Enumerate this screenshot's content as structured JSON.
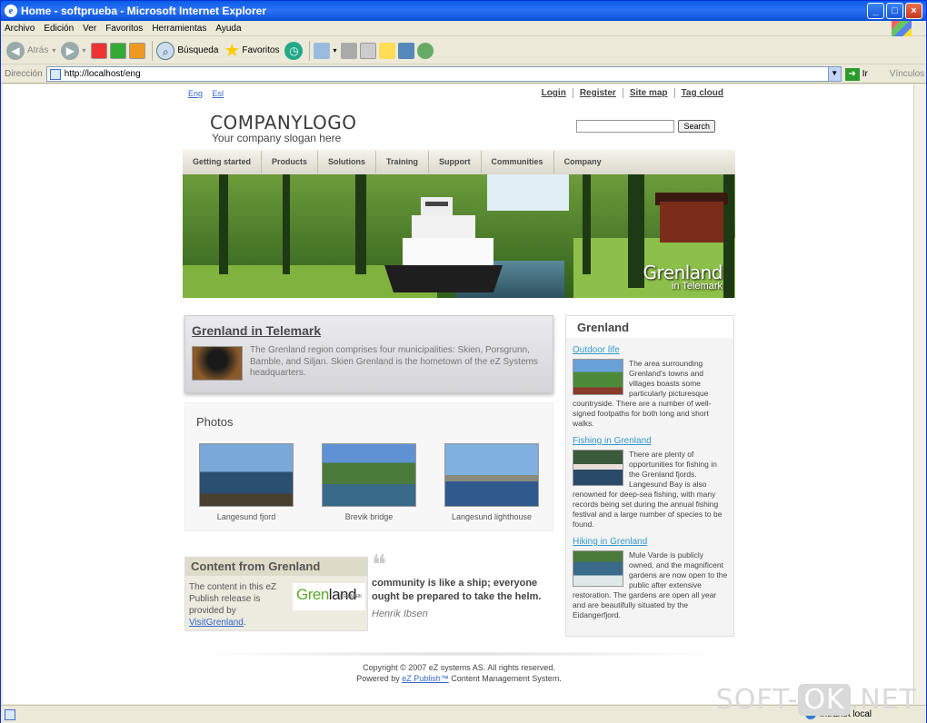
{
  "window": {
    "title": "Home - softprueba - Microsoft Internet Explorer",
    "min_label": "_",
    "max_label": "□",
    "close_label": "×"
  },
  "menu": [
    "Archivo",
    "Edición",
    "Ver",
    "Favoritos",
    "Herramientas",
    "Ayuda"
  ],
  "toolbar": {
    "back_label": "Atrás",
    "search_label": "Búsqueda",
    "favorites_label": "Favoritos"
  },
  "address": {
    "label": "Dirección",
    "url": "http://localhost/eng",
    "go_label": "Ir",
    "links_label": "Vínculos"
  },
  "status": {
    "zone": "Intranet local"
  },
  "watermark": {
    "pre": "SOFT-",
    "ok": "OK",
    "post": ".NET"
  },
  "site": {
    "lang": [
      "Eng",
      "Esl"
    ],
    "top_links": [
      "Login",
      "Register",
      "Site map",
      "Tag cloud"
    ],
    "logo": "COMPANYLOGO",
    "slogan": "Your company slogan here",
    "search_button": "Search",
    "nav": [
      "Getting started",
      "Products",
      "Solutions",
      "Training",
      "Support",
      "Communities",
      "Company"
    ],
    "banner_title": "Grenland",
    "banner_sub": "in Telemark",
    "feature": {
      "title": "Grenland in Telemark",
      "text": "The Grenland region comprises four municipalities: Skien, Porsgrunn, Bamble, and Siljan. Skien Grenland is the hometown of the eZ Systems headquarters."
    },
    "photos": {
      "title": "Photos",
      "items": [
        "Langesund fjord",
        "Brevik bridge",
        "Langesund lighthouse"
      ]
    },
    "content_from": {
      "title": "Content from Grenland",
      "text": "The content in this eZ Publish release is provided by ",
      "link": "VisitGrenland",
      "after": ".",
      "logo_a": "Gren",
      "logo_b": "land",
      "logo_small": "i TELEMARK"
    },
    "quote": {
      "mark": "❝",
      "text": "community is like a ship; everyone ought be prepared to take the helm.",
      "author": "Henrik Ibsen"
    },
    "sidebar": {
      "title": "Grenland",
      "sections": [
        {
          "link": "Outdoor life",
          "text": "The area surrounding Grenland's towns and villages boasts some particularly picturesque countryside. There are a number of well-signed footpaths for both long and short walks."
        },
        {
          "link": "Fishing in Grenland",
          "text": "There are plenty of opportunities for fishing in the Grenland fjords. Langesund Bay is also renowned for deep-sea fishing, with many records being set during the annual fishing festival and a large number of species to be found."
        },
        {
          "link": "Hiking in Grenland",
          "text": "Mule Varde is publicly owned, and the magnificent gardens are now open to the public after extensive restoration. The gardens are open all year and are beautifully situated by the Eidangerfjord."
        }
      ]
    },
    "footer": {
      "copyright": "Copyright © 2007 eZ systems AS. All rights reserved.",
      "powered_pre": "Powered by ",
      "powered_link": "eZ Publish™",
      "powered_post": " Content Management System."
    }
  }
}
